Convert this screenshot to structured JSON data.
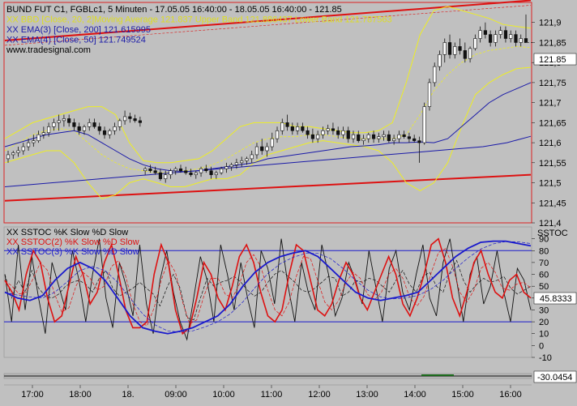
{
  "colors": {
    "background": "#c0c0c0",
    "plot_bg": "#c0c0c0",
    "frame": "#dd2222",
    "ema3": "#1a1aa8",
    "ema4": "#1a1aa8",
    "bband": "#eeee22",
    "channel": "#dd1111",
    "price": "#111111",
    "price_up": "#ffffff",
    "k_black": "#111111",
    "k_red": "#dd1111",
    "k_blue": "#1a1acc",
    "levels": "#1a1acc"
  },
  "price_legend": [
    {
      "text": "BUND FUT C1, FGBLc1, 5 Minuten - 17.05.05 16:40:00 - 18.05.05 16:40:00 - 121.85",
      "color": "#000000"
    },
    {
      "text": "XX BBD [Close, 20, 2]Moving Average 121.837 Upper Band 121.886437 Lower Band 121.787563",
      "color": "#dddd22"
    },
    {
      "text": "XX EMA(3) [Close, 200] 121.615995",
      "color": "#1a1aa8"
    },
    {
      "text": "XX EMA(4) [Close, 50] 121.749524",
      "color": "#1a1aa8"
    },
    {
      "text": "www.tradesignal.com",
      "color": "#000000"
    }
  ],
  "osc_legend": [
    {
      "text": "XX SSTOC %K Slow %D Slow",
      "color": "#000000"
    },
    {
      "text": "XX SSTOC(2) %K Slow %D Slow",
      "color": "#dd1111"
    },
    {
      "text": "XX SSTOC(3) %K Slow %D Slow",
      "color": "#1a1acc"
    }
  ],
  "osc_axis_title": "SSTOC",
  "last_price_label": "121.85",
  "last_osc_label": "45.8333",
  "bottom_value_label": "-30.0454",
  "chart_data": [
    {
      "type": "candlestick",
      "title": "BUND FUT C1, FGBLc1, 5 Minuten",
      "y_ticks": [
        "121,9",
        "121,85",
        "121,8",
        "121,75",
        "121,7",
        "121,65",
        "121,6",
        "121,55",
        "121,5",
        "121,45",
        "121,4"
      ],
      "ylim": [
        121.4,
        121.95
      ],
      "x_ticks": [
        "17:00",
        "18:00",
        "18.",
        "09:00",
        "10:00",
        "11:00",
        "12:00",
        "13:00",
        "14:00",
        "15:00",
        "16:00"
      ],
      "ohlc": [
        [
          121.56,
          121.58,
          121.55,
          121.57
        ],
        [
          121.57,
          121.58,
          121.56,
          121.575
        ],
        [
          121.575,
          121.59,
          121.565,
          121.58
        ],
        [
          121.58,
          121.6,
          121.57,
          121.59
        ],
        [
          121.59,
          121.61,
          121.58,
          121.6
        ],
        [
          121.6,
          121.62,
          121.59,
          121.605
        ],
        [
          121.605,
          121.63,
          121.6,
          121.62
        ],
        [
          121.62,
          121.64,
          121.61,
          121.625
        ],
        [
          121.625,
          121.65,
          121.615,
          121.64
        ],
        [
          121.64,
          121.66,
          121.63,
          121.65
        ],
        [
          121.65,
          121.67,
          121.63,
          121.655
        ],
        [
          121.655,
          121.67,
          121.64,
          121.66
        ],
        [
          121.66,
          121.67,
          121.64,
          121.65
        ],
        [
          121.65,
          121.66,
          121.63,
          121.64
        ],
        [
          121.64,
          121.65,
          121.62,
          121.63
        ],
        [
          121.63,
          121.645,
          121.62,
          121.64
        ],
        [
          121.64,
          121.66,
          121.63,
          121.65
        ],
        [
          121.65,
          121.66,
          121.635,
          121.64
        ],
        [
          121.64,
          121.65,
          121.62,
          121.63
        ],
        [
          121.63,
          121.64,
          121.61,
          121.62
        ],
        [
          121.62,
          121.635,
          121.61,
          121.63
        ],
        [
          121.63,
          121.65,
          121.62,
          121.64
        ],
        [
          121.64,
          121.66,
          121.63,
          121.655
        ],
        [
          121.655,
          121.68,
          121.645,
          121.665
        ],
        [
          121.665,
          121.675,
          121.65,
          121.66
        ],
        [
          121.66,
          121.67,
          121.65,
          121.655
        ],
        [
          121.655,
          121.665,
          121.64,
          121.65
        ],
        [
          121.53,
          121.54,
          121.52,
          121.535
        ],
        [
          121.535,
          121.545,
          121.525,
          121.53
        ],
        [
          121.53,
          121.54,
          121.52,
          121.525
        ],
        [
          121.525,
          121.535,
          121.505,
          121.51
        ],
        [
          121.51,
          121.53,
          121.5,
          121.52
        ],
        [
          121.52,
          121.535,
          121.51,
          121.53
        ],
        [
          121.53,
          121.54,
          121.52,
          121.535
        ],
        [
          121.535,
          121.545,
          121.525,
          121.53
        ],
        [
          121.53,
          121.54,
          121.52,
          121.525
        ],
        [
          121.525,
          121.535,
          121.515,
          121.52
        ],
        [
          121.52,
          121.53,
          121.51,
          121.525
        ],
        [
          121.525,
          121.54,
          121.515,
          121.535
        ],
        [
          121.535,
          121.545,
          121.525,
          121.53
        ],
        [
          121.53,
          121.54,
          121.51,
          121.52
        ],
        [
          121.52,
          121.53,
          121.51,
          121.525
        ],
        [
          121.525,
          121.54,
          121.52,
          121.535
        ],
        [
          121.535,
          121.55,
          121.525,
          121.54
        ],
        [
          121.54,
          121.55,
          121.53,
          121.545
        ],
        [
          121.545,
          121.56,
          121.535,
          121.55
        ],
        [
          121.55,
          121.565,
          121.54,
          121.555
        ],
        [
          121.555,
          121.565,
          121.545,
          121.56
        ],
        [
          121.56,
          121.58,
          121.55,
          121.57
        ],
        [
          121.57,
          121.6,
          121.56,
          121.59
        ],
        [
          121.59,
          121.61,
          121.57,
          121.58
        ],
        [
          121.58,
          121.6,
          121.565,
          121.59
        ],
        [
          121.59,
          121.625,
          121.58,
          121.61
        ],
        [
          121.61,
          121.64,
          121.6,
          121.63
        ],
        [
          121.63,
          121.66,
          121.62,
          121.65
        ],
        [
          121.65,
          121.67,
          121.63,
          121.64
        ],
        [
          121.64,
          121.65,
          121.62,
          121.63
        ],
        [
          121.63,
          121.65,
          121.62,
          121.64
        ],
        [
          121.64,
          121.65,
          121.625,
          121.63
        ],
        [
          121.63,
          121.64,
          121.61,
          121.62
        ],
        [
          121.62,
          121.635,
          121.6,
          121.61
        ],
        [
          121.61,
          121.63,
          121.6,
          121.62
        ],
        [
          121.62,
          121.64,
          121.61,
          121.63
        ],
        [
          121.63,
          121.645,
          121.62,
          121.635
        ],
        [
          121.635,
          121.65,
          121.62,
          121.63
        ],
        [
          121.63,
          121.64,
          121.61,
          121.62
        ],
        [
          121.62,
          121.64,
          121.61,
          121.63
        ],
        [
          121.63,
          121.64,
          121.6,
          121.61
        ],
        [
          121.61,
          121.63,
          121.6,
          121.62
        ],
        [
          121.62,
          121.63,
          121.6,
          121.605
        ],
        [
          121.605,
          121.62,
          121.595,
          121.61
        ],
        [
          121.61,
          121.625,
          121.6,
          121.62
        ],
        [
          121.62,
          121.63,
          121.6,
          121.61
        ],
        [
          121.61,
          121.625,
          121.6,
          121.615
        ],
        [
          121.615,
          121.63,
          121.605,
          121.62
        ],
        [
          121.62,
          121.63,
          121.6,
          121.605
        ],
        [
          121.605,
          121.62,
          121.595,
          121.61
        ],
        [
          121.61,
          121.63,
          121.6,
          121.62
        ],
        [
          121.62,
          121.63,
          121.61,
          121.615
        ],
        [
          121.615,
          121.625,
          121.6,
          121.61
        ],
        [
          121.61,
          121.62,
          121.6,
          121.605
        ],
        [
          121.605,
          121.615,
          121.55,
          121.6
        ],
        [
          121.6,
          121.7,
          121.595,
          121.69
        ],
        [
          121.69,
          121.76,
          121.68,
          121.75
        ],
        [
          121.75,
          121.8,
          121.74,
          121.79
        ],
        [
          121.79,
          121.83,
          121.78,
          121.82
        ],
        [
          121.82,
          121.86,
          121.8,
          121.85
        ],
        [
          121.85,
          121.87,
          121.81,
          121.82
        ],
        [
          121.82,
          121.85,
          121.81,
          121.84
        ],
        [
          121.84,
          121.86,
          121.82,
          121.83
        ],
        [
          121.83,
          121.85,
          121.8,
          121.81
        ],
        [
          121.81,
          121.84,
          121.8,
          121.835
        ],
        [
          121.835,
          121.87,
          121.83,
          121.86
        ],
        [
          121.86,
          121.89,
          121.85,
          121.88
        ],
        [
          121.88,
          121.9,
          121.86,
          121.87
        ],
        [
          121.87,
          121.88,
          121.84,
          121.85
        ],
        [
          121.85,
          121.88,
          121.84,
          121.87
        ],
        [
          121.87,
          121.89,
          121.86,
          121.88
        ],
        [
          121.88,
          121.89,
          121.85,
          121.86
        ],
        [
          121.86,
          121.88,
          121.85,
          121.87
        ],
        [
          121.87,
          121.88,
          121.84,
          121.85
        ],
        [
          121.85,
          121.87,
          121.84,
          121.86
        ],
        [
          121.86,
          121.92,
          121.85,
          121.85
        ]
      ],
      "ema4_close_50": [
        121.59,
        121.6,
        121.61,
        121.62,
        121.625,
        121.63,
        121.62,
        121.6,
        121.58,
        121.56,
        121.545,
        121.535,
        121.53,
        121.528,
        121.53,
        121.535,
        121.54,
        121.545,
        121.55,
        121.56,
        121.565,
        121.57,
        121.575,
        121.58,
        121.585,
        121.59,
        121.592,
        121.595,
        121.6,
        121.6,
        121.602,
        121.6,
        121.61,
        121.64,
        121.67,
        121.7,
        121.72,
        121.735,
        121.75
      ],
      "ema3_close_200": [
        121.49,
        121.495,
        121.5,
        121.505,
        121.51,
        121.515,
        121.52,
        121.525,
        121.53,
        121.535,
        121.54,
        121.545,
        121.55,
        121.555,
        121.56,
        121.565,
        121.57,
        121.575,
        121.58,
        121.585,
        121.59,
        121.6,
        121.616
      ],
      "upper_channel": [
        121.855,
        121.955
      ],
      "lower_channel": [
        121.455,
        121.52
      ],
      "bb_ma": [
        121.58,
        121.6,
        121.62,
        121.63,
        121.635,
        121.63,
        121.6,
        121.57,
        121.55,
        121.535,
        121.53,
        121.525,
        121.525,
        121.53,
        121.535,
        121.545,
        121.56,
        121.58,
        121.6,
        121.61,
        121.615,
        121.615,
        121.62,
        121.62,
        121.615,
        121.61,
        121.61,
        121.61,
        121.61,
        121.62,
        121.67,
        121.73,
        121.77,
        121.8,
        121.82,
        121.83,
        121.835,
        121.84,
        121.837
      ],
      "bb_upper": [
        121.61,
        121.63,
        121.65,
        121.66,
        121.67,
        121.68,
        121.69,
        121.69,
        121.67,
        121.6,
        121.555,
        121.55,
        121.55,
        121.555,
        121.56,
        121.58,
        121.61,
        121.64,
        121.65,
        121.65,
        121.65,
        121.64,
        121.64,
        121.635,
        121.63,
        121.625,
        121.625,
        121.63,
        121.65,
        121.75,
        121.87,
        121.93,
        121.94,
        121.93,
        121.92,
        121.91,
        121.895,
        121.89,
        121.886
      ],
      "bb_lower": [
        121.55,
        121.56,
        121.57,
        121.58,
        121.58,
        121.55,
        121.5,
        121.46,
        121.47,
        121.5,
        121.51,
        121.5,
        121.49,
        121.49,
        121.5,
        121.51,
        121.51,
        121.52,
        121.55,
        121.57,
        121.58,
        121.59,
        121.6,
        121.605,
        121.6,
        121.595,
        121.59,
        121.58,
        121.55,
        121.5,
        121.48,
        121.5,
        121.55,
        121.64,
        121.72,
        121.75,
        121.77,
        121.785,
        121.788
      ]
    },
    {
      "type": "line",
      "title": "SSTOC",
      "ylim": [
        -10,
        100
      ],
      "y_ticks": [
        90,
        80,
        70,
        60,
        50,
        40,
        30,
        20,
        10,
        0,
        -10
      ],
      "levels": [
        80,
        20
      ],
      "series": [
        {
          "name": "XX SSTOC %K Slow %D Slow",
          "values": [
            60,
            20,
            85,
            30,
            75,
            40,
            10,
            70,
            50,
            30,
            80,
            55,
            20,
            60,
            90,
            40,
            15,
            70,
            50,
            25,
            85,
            35,
            10,
            55,
            80,
            45,
            20,
            5,
            40,
            75,
            55,
            20,
            85,
            60,
            30,
            70,
            40,
            15,
            80,
            65,
            35,
            90,
            50,
            20,
            70,
            45,
            30,
            85,
            60,
            25,
            40,
            70,
            55,
            35,
            80,
            50,
            20,
            65,
            80,
            45,
            30,
            60,
            85,
            40,
            25,
            70,
            90,
            55,
            20,
            60,
            75,
            35,
            50,
            80,
            45,
            20,
            65,
            55,
            30
          ]
        },
        {
          "name": "XX SSTOC(2) %K Slow %D Slow",
          "values": [
            55,
            45,
            30,
            60,
            80,
            70,
            40,
            20,
            25,
            50,
            75,
            60,
            35,
            45,
            70,
            85,
            60,
            30,
            15,
            15,
            20,
            60,
            85,
            70,
            30,
            10,
            15,
            40,
            70,
            60,
            40,
            30,
            50,
            75,
            85,
            70,
            45,
            25,
            20,
            30,
            60,
            85,
            80,
            55,
            30,
            25,
            35,
            55,
            70,
            60,
            40,
            30,
            45,
            60,
            75,
            60,
            35,
            25,
            40,
            60,
            85,
            90,
            70,
            40,
            25,
            45,
            70,
            80,
            60,
            45,
            40,
            55,
            60,
            45,
            40
          ]
        },
        {
          "name": "XX SSTOC(3) %K Slow %D Slow",
          "values": [
            45,
            40,
            38,
            42,
            55,
            65,
            70,
            65,
            55,
            40,
            25,
            15,
            12,
            10,
            12,
            15,
            20,
            25,
            35,
            50,
            62,
            70,
            75,
            78,
            80,
            75,
            65,
            55,
            45,
            40,
            38,
            40,
            42,
            45,
            55,
            65,
            75,
            82,
            87,
            88,
            88,
            86,
            84
          ]
        }
      ]
    }
  ]
}
